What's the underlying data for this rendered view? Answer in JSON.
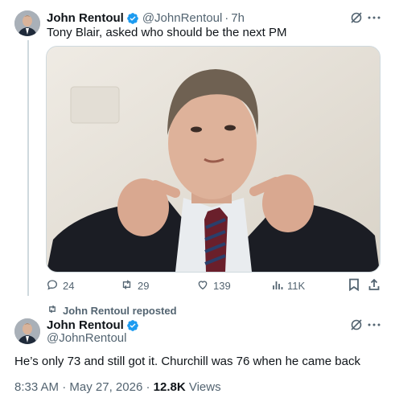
{
  "tweet1": {
    "name": "John Rentoul",
    "handle": "@JohnRentoul",
    "separator": "·",
    "time": "7h",
    "text": "Tony Blair, asked who should be the next PM",
    "stats": {
      "replies": "24",
      "reposts": "29",
      "likes": "139",
      "views": "11K"
    }
  },
  "repost_banner": {
    "text": "John Rentoul reposted"
  },
  "tweet2": {
    "name": "John Rentoul",
    "handle": "@JohnRentoul",
    "text": "He’s only 73 and still got it. Churchill was 76 when he came back",
    "timestamp": "8:33 AM",
    "date": "May 27, 2026",
    "separator": "·",
    "views_count": "12.8K",
    "views_label": "Views"
  },
  "icons": [
    "verified-badge-icon",
    "grok-icon",
    "more-icon",
    "reply-icon",
    "repost-icon",
    "like-icon",
    "views-icon",
    "bookmark-icon",
    "share-icon"
  ],
  "colors": {
    "verified": "#1d9bf0",
    "text_primary": "#0f1419",
    "text_secondary": "#536471",
    "thread_line": "#cfd9de"
  }
}
